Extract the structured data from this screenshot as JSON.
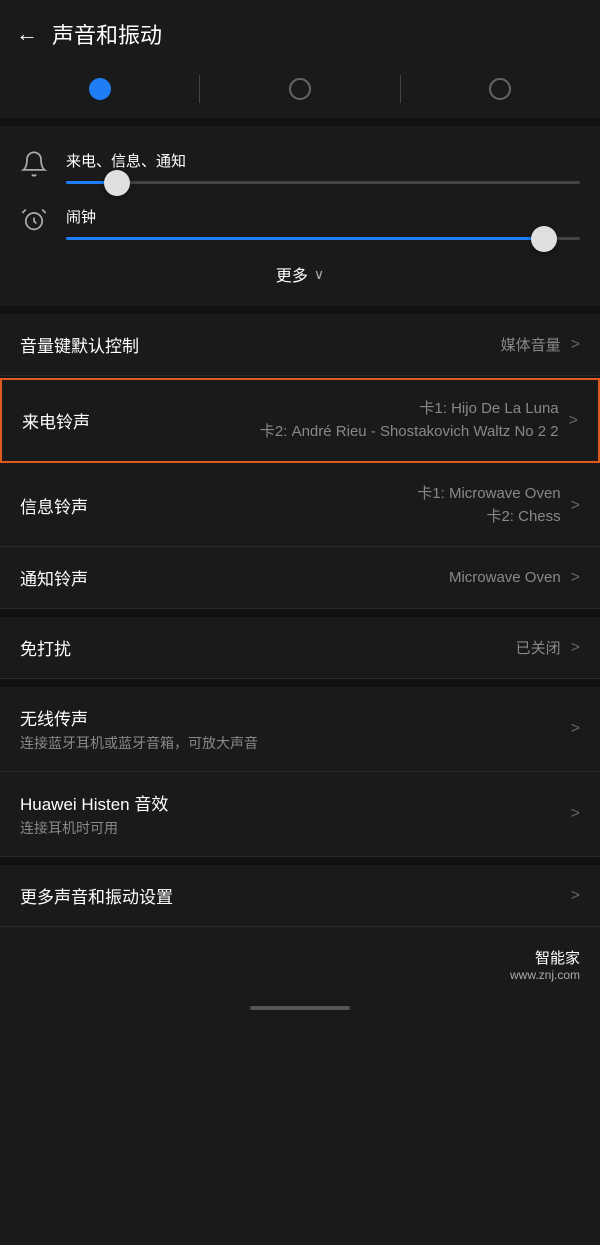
{
  "header": {
    "back_icon": "←",
    "title": "声音和振动"
  },
  "tabs": [
    {
      "id": "tab1",
      "active": true
    },
    {
      "id": "tab2",
      "active": false
    },
    {
      "id": "tab3",
      "active": false
    }
  ],
  "volume": {
    "incoming_label": "来电、信息、通知",
    "incoming_value": 10,
    "incoming_max": 100,
    "alarm_label": "闹钟",
    "alarm_value": 95,
    "alarm_max": 100
  },
  "more": {
    "label": "更多",
    "chevron": "∨"
  },
  "settings": [
    {
      "id": "volume-key-control",
      "label": "音量键默认控制",
      "value": "媒体音量",
      "chevron": ">"
    },
    {
      "id": "ringtone",
      "label": "来电铃声",
      "value_line1": "卡1: Hijo De La Luna",
      "value_line2": "卡2: André Rieu - Shostakovich Waltz No 2 2",
      "chevron": ">",
      "highlighted": true
    },
    {
      "id": "message-tone",
      "label": "信息铃声",
      "value_line1": "卡1: Microwave Oven",
      "value_line2": "卡2: Chess",
      "chevron": ">"
    },
    {
      "id": "notification-tone",
      "label": "通知铃声",
      "value": "Microwave Oven",
      "chevron": ">"
    },
    {
      "id": "do-not-disturb",
      "label": "免打扰",
      "value": "已关闭",
      "chevron": ">"
    },
    {
      "id": "wireless-transmission",
      "label": "无线传声",
      "sublabel": "连接蓝牙耳机或蓝牙音箱，可放大声音",
      "chevron": ">"
    },
    {
      "id": "huawei-histen",
      "label": "Huawei Histen 音效",
      "sublabel": "连接耳机时可用",
      "chevron": ">"
    },
    {
      "id": "more-sound",
      "label": "更多声音和振动设置",
      "chevron": ">"
    }
  ],
  "watermark": {
    "main": "智能家",
    "sub": "www.znj.com"
  }
}
